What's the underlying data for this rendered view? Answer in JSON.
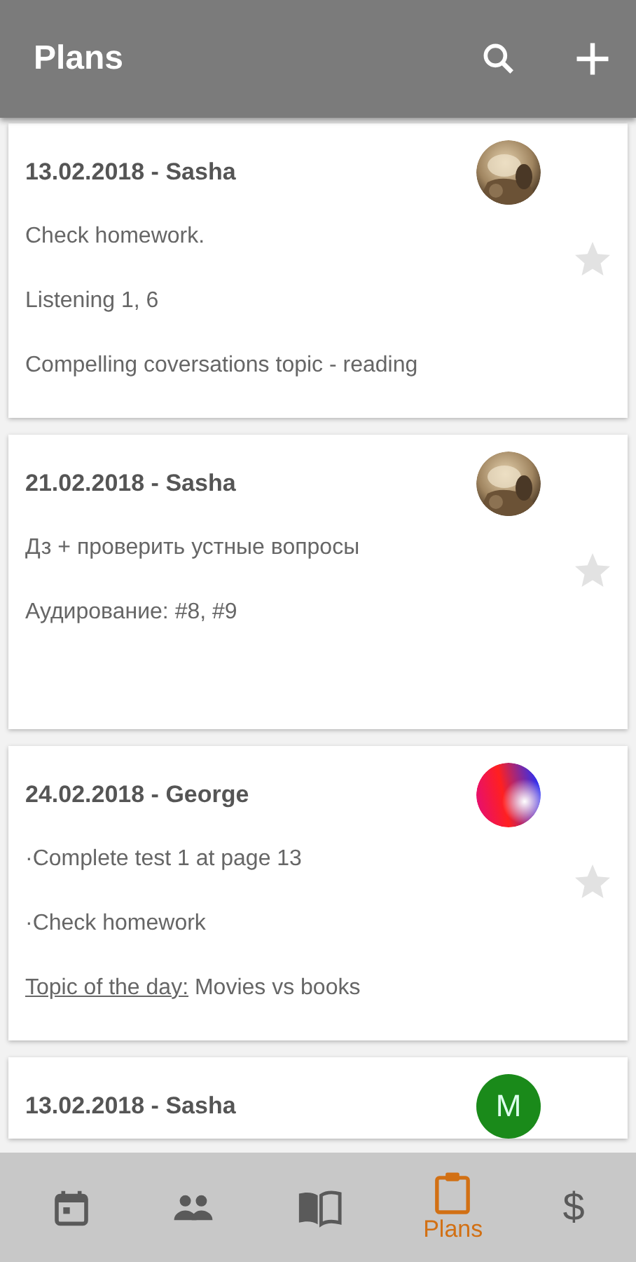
{
  "app_bar": {
    "title": "Plans"
  },
  "plans": [
    {
      "heading": "13.02.2018 - Sasha",
      "avatar": {
        "kind": "picture"
      },
      "starred": false,
      "lines": [
        {
          "text": "Check homework."
        },
        {
          "text": "Listening 1,  6"
        },
        {
          "text": "Compelling coversations topic - reading"
        }
      ]
    },
    {
      "heading": "21.02.2018 - Sasha",
      "avatar": {
        "kind": "picture"
      },
      "starred": false,
      "lines": [
        {
          "text": "Дз + проверить устные вопросы"
        },
        {
          "text": "Аудирование: #8, #9"
        }
      ]
    },
    {
      "heading": "24.02.2018 - George",
      "avatar": {
        "kind": "gradient"
      },
      "starred": false,
      "lines": [
        {
          "text": "·Complete test 1 at page 13"
        },
        {
          "text": "·Check homework"
        },
        {
          "label": "Topic of the day:",
          "text": " Movies vs books"
        }
      ]
    },
    {
      "heading": "13.02.2018 - Sasha",
      "avatar": {
        "kind": "letter",
        "letter": "M",
        "color": "#1a8a1a"
      }
    }
  ],
  "bottom_nav": [
    {
      "kind": "calendar",
      "selected": false
    },
    {
      "kind": "people",
      "selected": false
    },
    {
      "kind": "book",
      "selected": false
    },
    {
      "kind": "clipboard",
      "label": "Plans",
      "selected": true
    },
    {
      "kind": "text",
      "glyph": "$",
      "selected": false
    }
  ]
}
